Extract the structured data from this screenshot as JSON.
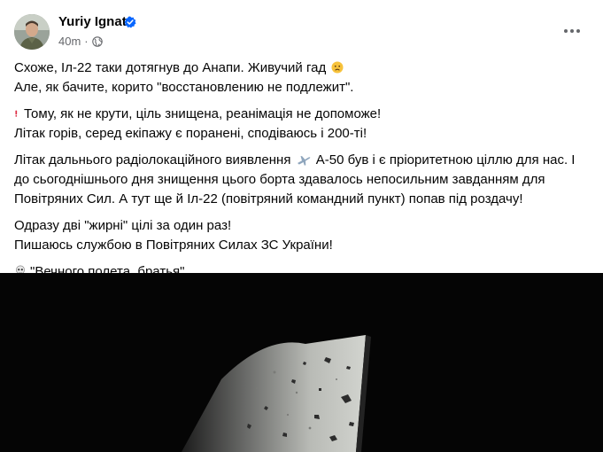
{
  "post": {
    "author": "Yuriy Ignat",
    "time": "40m",
    "separator": "·",
    "more_label": "···",
    "paragraphs": [
      [
        "Схоже, Іл-22 таки дотягнув до Анапи. Живучий гад",
        "Але, як бачите, корито \"восстановлению не подлежит\"."
      ],
      [
        "Тому, як не крути, ціль знищена, реанімація не допоможе!",
        "Літак горів, серед екіпажу є поранені, сподіваюсь і 200-ті!"
      ],
      [
        "Літак дальнього радіолокаційного виявлення",
        "А-50 був і є пріоритетною ціллю для нас. І",
        "до сьогоднішнього дня знищення цього борта здавалось непосильним завданням для",
        "Повітряних Сил. А тут ще й Іл-22 (повітряний командний пункт) попав під роздачу!"
      ],
      [
        "Одразу дві \"жирні\" цілі за один раз!",
        "Пишаюсь службою в Повітряних Силах ЗС України!"
      ],
      [
        "\"Вечного полета, братья\""
      ]
    ]
  },
  "icons": {
    "verified": "verified-badge-icon",
    "globe": "globe-icon",
    "face": "worried-face-emoji",
    "exclamation": "red-exclamation-emoji",
    "plane": "airplane-emoji",
    "skull": "skull-crossbones-emoji"
  },
  "colors": {
    "text": "#050505",
    "secondary": "#65676b",
    "verified": "#0866ff",
    "exclamation": "#e0245e"
  }
}
